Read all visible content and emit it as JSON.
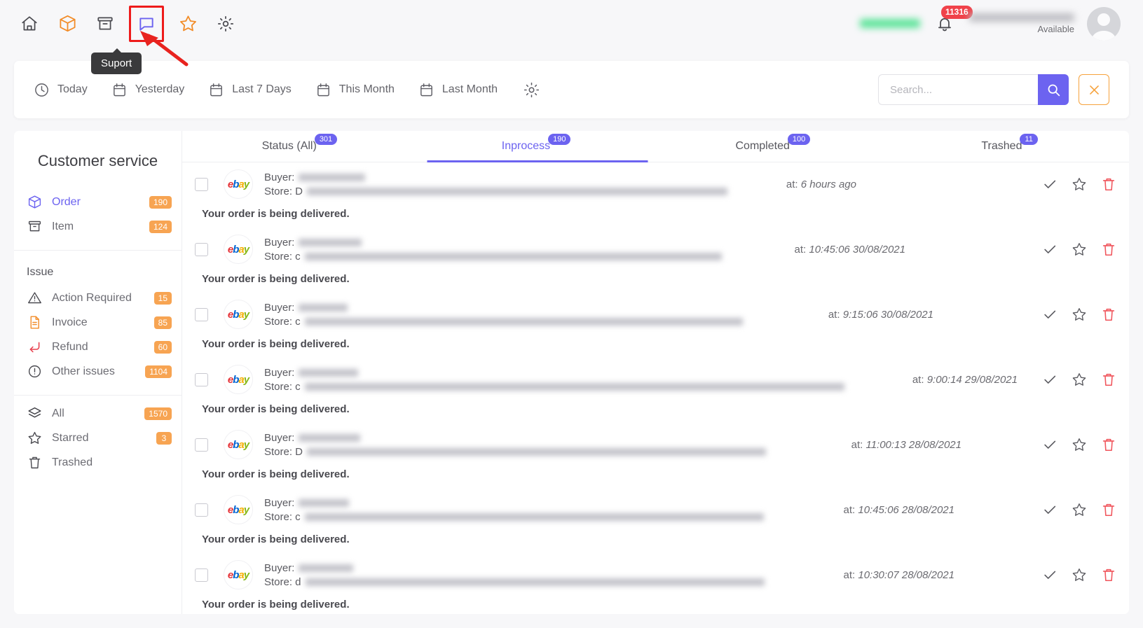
{
  "topnav": {
    "icons": [
      {
        "name": "home-icon",
        "label": "Home"
      },
      {
        "name": "package-icon",
        "label": "Orders"
      },
      {
        "name": "archive-icon",
        "label": "Items"
      },
      {
        "name": "chat-icon",
        "label": "Support"
      },
      {
        "name": "star-icon",
        "label": "Starred"
      },
      {
        "name": "gear-icon",
        "label": "Settings"
      }
    ],
    "tooltip": "Suport",
    "notification_count": "11316",
    "availability": "Available",
    "colors": {
      "highlight_border": "#ee1b1b",
      "accent_purple": "#6c63f0",
      "accent_orange": "#f7a452",
      "badge_red": "#f0424a"
    }
  },
  "filterbar": {
    "date_filters": [
      {
        "label": "Today",
        "icon": "clock-icon"
      },
      {
        "label": "Yesterday",
        "icon": "calendar-icon"
      },
      {
        "label": "Last 7 Days",
        "icon": "calendar-icon"
      },
      {
        "label": "This Month",
        "icon": "calendar-icon"
      },
      {
        "label": "Last Month",
        "icon": "calendar-icon"
      }
    ],
    "settings_icon": "gear-icon",
    "search_placeholder": "Search...",
    "search_value": "",
    "search_button_icon": "search-icon",
    "close_button_icon": "close-icon"
  },
  "sidebar": {
    "title": "Customer service",
    "groups": [
      {
        "heading": "",
        "items": [
          {
            "label": "Order",
            "badge": "190",
            "icon": "package-icon",
            "active": true
          },
          {
            "label": "Item",
            "badge": "124",
            "icon": "archive-icon",
            "active": false
          }
        ]
      },
      {
        "heading": "Issue",
        "items": [
          {
            "label": "Action Required",
            "badge": "15",
            "icon": "warning-icon",
            "active": false
          },
          {
            "label": "Invoice",
            "badge": "85",
            "icon": "document-icon",
            "active": false
          },
          {
            "label": "Refund",
            "badge": "60",
            "icon": "return-arrow-icon",
            "active": false
          },
          {
            "label": "Other issues",
            "badge": "1104",
            "icon": "info-icon",
            "active": false
          }
        ]
      },
      {
        "heading": "",
        "items": [
          {
            "label": "All",
            "badge": "1570",
            "icon": "layers-icon",
            "active": false
          },
          {
            "label": "Starred",
            "badge": "3",
            "icon": "star-icon",
            "active": false
          },
          {
            "label": "Trashed",
            "badge": "",
            "icon": "trash-icon",
            "active": false
          }
        ]
      }
    ]
  },
  "content": {
    "tabs": [
      {
        "label": "Status (All)",
        "badge": "301",
        "active": false
      },
      {
        "label": "Inprocess",
        "badge": "190",
        "active": true
      },
      {
        "label": "Completed",
        "badge": "100",
        "active": false
      },
      {
        "label": "Trashed",
        "badge": "11",
        "active": false
      }
    ],
    "row_labels": {
      "buyer": "Buyer:",
      "store": "Store:",
      "at": "at:"
    },
    "row_actions": [
      {
        "name": "mark-done-icon"
      },
      {
        "name": "star-icon"
      },
      {
        "name": "trash-icon"
      }
    ],
    "rows": [
      {
        "platform": "ebay",
        "time": "6 hours ago",
        "message": "Your order is being delivered.",
        "store_prefix": "D",
        "buyer_blur_w": 95,
        "store_blur_w": 600,
        "time_pad": 255
      },
      {
        "platform": "ebay",
        "time": "10:45:06 30/08/2021",
        "message": "Your order is being delivered.",
        "store_prefix": "c",
        "buyer_blur_w": 90,
        "store_blur_w": 595,
        "time_pad": 185
      },
      {
        "platform": "ebay",
        "time": "9:15:06 30/08/2021",
        "message": "Your order is being delivered.",
        "store_prefix": "c",
        "buyer_blur_w": 70,
        "store_blur_w": 625,
        "time_pad": 145
      },
      {
        "platform": "ebay",
        "time": "9:00:14 29/08/2021",
        "message": "Your order is being delivered.",
        "store_prefix": "c",
        "buyer_blur_w": 85,
        "store_blur_w": 770,
        "time_pad": 25
      },
      {
        "platform": "ebay",
        "time": "11:00:13 28/08/2021",
        "message": "Your order is being delivered.",
        "store_prefix": "D",
        "buyer_blur_w": 88,
        "store_blur_w": 655,
        "time_pad": 105
      },
      {
        "platform": "ebay",
        "time": "10:45:06 28/08/2021",
        "message": "Your order is being delivered.",
        "store_prefix": "c",
        "buyer_blur_w": 72,
        "store_blur_w": 655,
        "time_pad": 115
      },
      {
        "platform": "ebay",
        "time": "10:30:07 28/08/2021",
        "message": "Your order is being delivered.",
        "store_prefix": "d",
        "buyer_blur_w": 78,
        "store_blur_w": 655,
        "time_pad": 115
      }
    ]
  }
}
